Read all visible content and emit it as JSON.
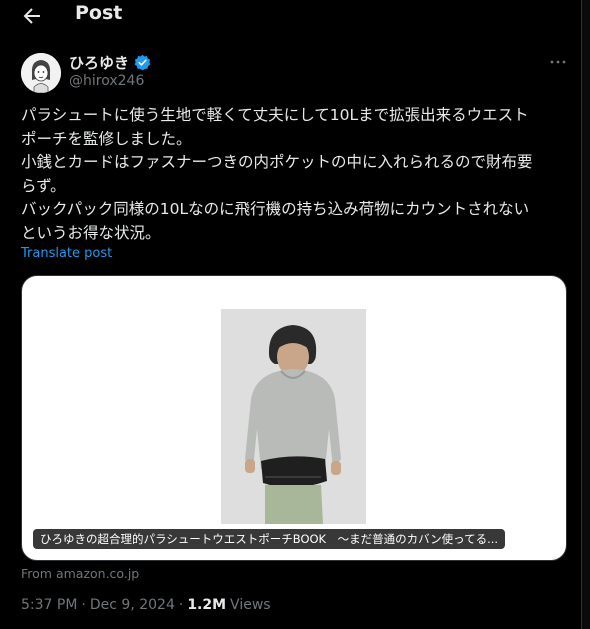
{
  "header": {
    "title": "Post"
  },
  "author": {
    "name": "ひろゆき",
    "handle": "@hirox246"
  },
  "tweet": {
    "text": "パラシュートに使う生地で軽くて丈夫にして10Lまで拡張出来るウエスト\nポーチを監修しました。\n小銭とカードはファスナーつきの内ポケットの中に入れられるので財布要\nらず。\nバックパック同様の10Lなのに飛行機の持ち込み荷物にカウントされない\nというお得な状況。",
    "translate_label": "Translate post"
  },
  "card": {
    "caption": "ひろゆきの超合理的パラシュートウエストポーチBOOK　～まだ普通のカバン使ってる...",
    "source": "From amazon.co.jp"
  },
  "meta": {
    "time": "5:37 PM",
    "sep1": "·",
    "date": "Dec 9, 2024",
    "sep2": "·",
    "views_count": "1.2M",
    "views_label": "Views"
  },
  "icons": {
    "back": "back-arrow-icon",
    "verified": "verified-badge-icon",
    "more": "more-options-icon"
  },
  "colors": {
    "accent": "#1d9bf0",
    "background": "#000000",
    "text": "#e7e9ea",
    "secondary": "#71767b"
  }
}
